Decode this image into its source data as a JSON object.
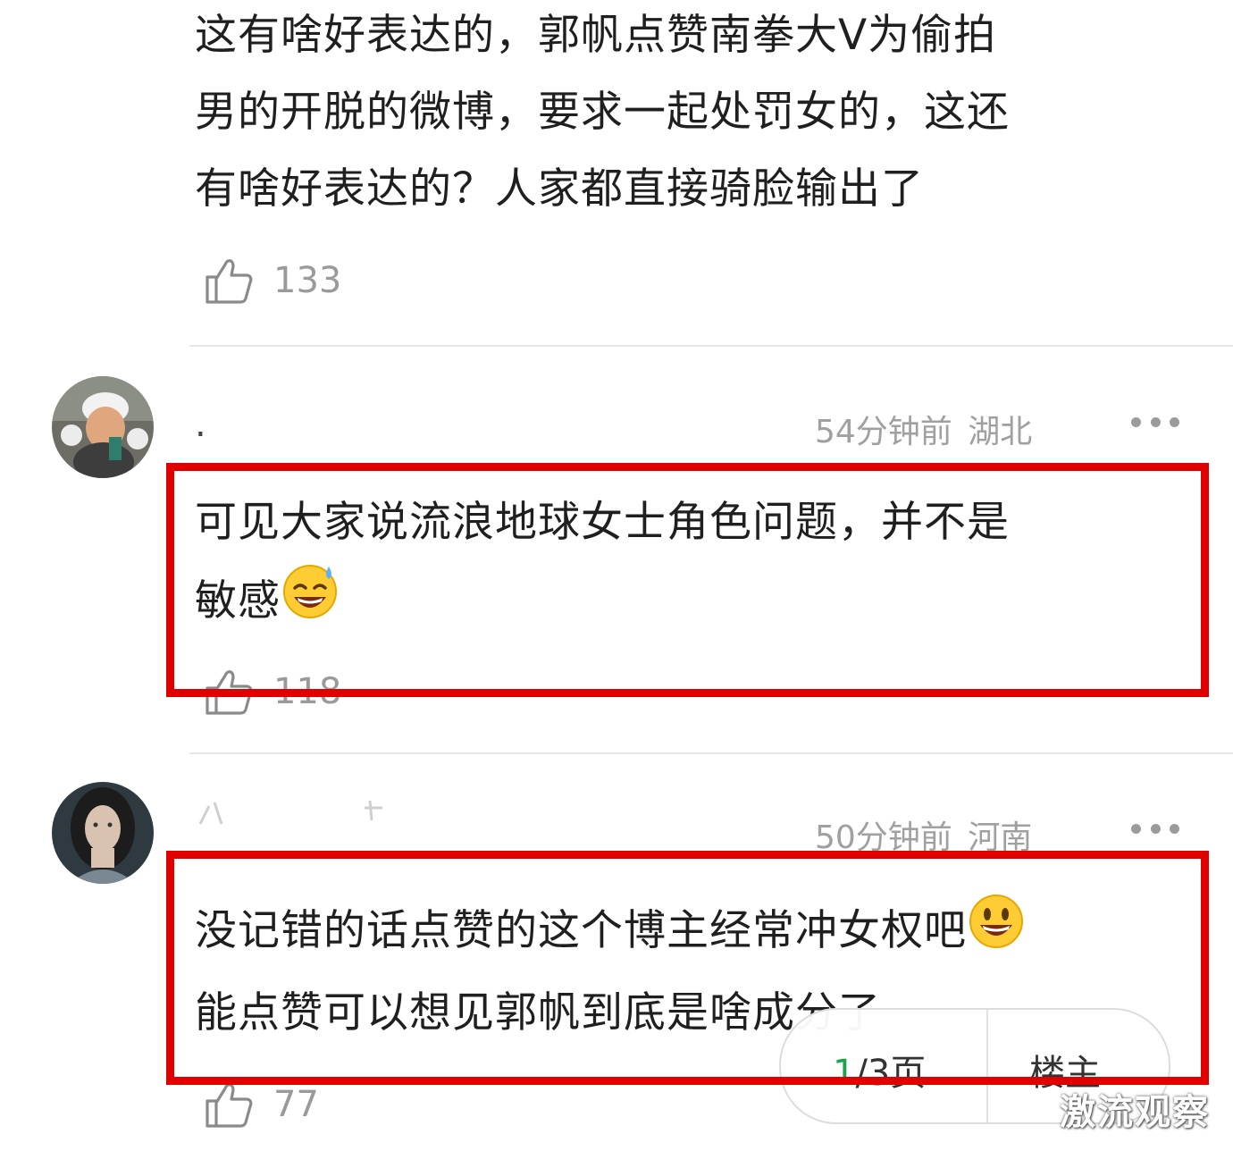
{
  "comments": [
    {
      "username": "",
      "time": "",
      "location": "",
      "text_lines": [
        "这有啥好表达的，郭帆点赞南拳大V为偷拍",
        "男的开脱的微博，要求一起处罚女的，这还",
        "有啥好表达的？人家都直接骑脸输出了"
      ],
      "likes": "133"
    },
    {
      "username": ".",
      "time": "54分钟前",
      "location": "湖北",
      "text_lines": [
        "可见大家说流浪地球女士角色问题，并不是",
        "敏感"
      ],
      "emoji": "sweat-smile-emoji",
      "likes": "118",
      "highlighted": true
    },
    {
      "username": "",
      "time": "50分钟前",
      "location": "河南",
      "text_lines": [
        "没记错的话点赞的这个博主经常冲女权吧",
        "能点赞可以想见郭帆到底是啥成分了"
      ],
      "emoji": "smiley-emoji",
      "likes": "77",
      "highlighted": true
    }
  ],
  "pager": {
    "current": "1",
    "rest": "/3页",
    "owner_label": "楼主"
  },
  "watermark": "激流观察",
  "colors": {
    "highlight": "#e00000",
    "pager_current": "#1aa34a",
    "meta": "#a0a0a0"
  }
}
